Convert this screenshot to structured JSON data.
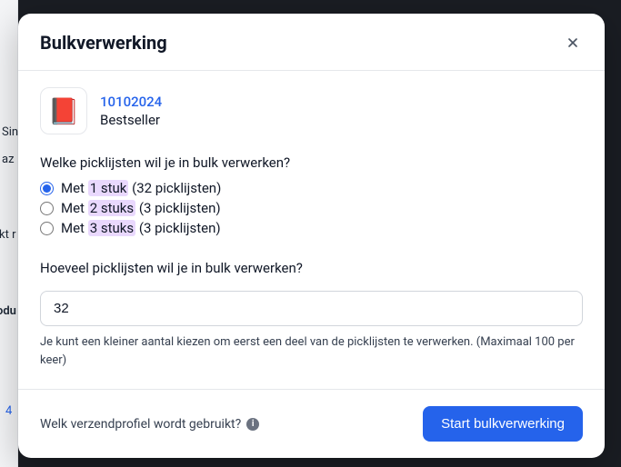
{
  "modal": {
    "title": "Bulkverwerking",
    "product": {
      "code": "10102024",
      "name": "Bestseller",
      "icon": "📕"
    },
    "question1": "Welke picklijsten wil je in bulk verwerken?",
    "options": [
      {
        "prefix": "Met ",
        "highlight": "1 stuk",
        "suffix": " (32 picklijsten)",
        "selected": true
      },
      {
        "prefix": "Met ",
        "highlight": "2 stuks",
        "suffix": " (3 picklijsten)",
        "selected": false
      },
      {
        "prefix": "Met ",
        "highlight": "3 stuks",
        "suffix": " (3 picklijsten)",
        "selected": false
      }
    ],
    "question2": "Hoeveel picklijsten wil je in bulk verwerken?",
    "countValue": "32",
    "helper": "Je kunt een kleiner aantal kiezen om eerst een deel van de picklijsten te verwerken. (Maximaal 100 per keer)",
    "footerQuestion": "Welk verzendprofiel wordt gebruikt?",
    "submitLabel": "Start bulkverwerking"
  },
  "backdrop": {
    "t1": "Sin",
    "t2": "az",
    "t3": "kt r",
    "t4": "odu",
    "t5": "4"
  }
}
